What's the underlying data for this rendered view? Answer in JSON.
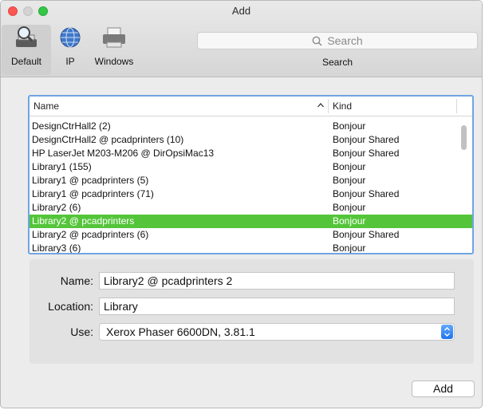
{
  "window": {
    "title": "Add"
  },
  "toolbar": {
    "tools": [
      {
        "label": "Default",
        "icon": "default-printer-icon",
        "selected": true
      },
      {
        "label": "IP",
        "icon": "globe-icon"
      },
      {
        "label": "Windows",
        "icon": "windows-printer-icon"
      }
    ],
    "search": {
      "placeholder": "Search",
      "label": "Search"
    }
  },
  "table": {
    "columns": {
      "name": "Name",
      "kind": "Kind",
      "sort_indicator": "^"
    },
    "rows": [
      {
        "name": "DesignCtrHall2 (2)",
        "kind": "Bonjour"
      },
      {
        "name": "DesignCtrHall2 @ pcadprinters (10)",
        "kind": "Bonjour Shared"
      },
      {
        "name": "HP LaserJet M203-M206 @ DirOpsiMac13",
        "kind": "Bonjour Shared"
      },
      {
        "name": "Library1 (155)",
        "kind": "Bonjour"
      },
      {
        "name": "Library1 @ pcadprinters (5)",
        "kind": "Bonjour"
      },
      {
        "name": "Library1 @ pcadprinters (71)",
        "kind": "Bonjour Shared"
      },
      {
        "name": "Library2 (6)",
        "kind": "Bonjour"
      },
      {
        "name": "Library2 @ pcadprinters",
        "kind": "Bonjour",
        "selected": true
      },
      {
        "name": "Library2 @ pcadprinters (6)",
        "kind": "Bonjour Shared"
      },
      {
        "name": "Library3 (6)",
        "kind": "Bonjour"
      }
    ]
  },
  "form": {
    "name_label": "Name:",
    "name_value": "Library2 @ pcadprinters 2",
    "location_label": "Location:",
    "location_value": "Library",
    "use_label": "Use:",
    "use_value": "Xerox Phaser 6600DN, 3.81.1"
  },
  "buttons": {
    "add": "Add"
  },
  "colors": {
    "selection": "#54c53a",
    "focus_ring": "#6fa5e3",
    "accent": "#1e74f0"
  }
}
